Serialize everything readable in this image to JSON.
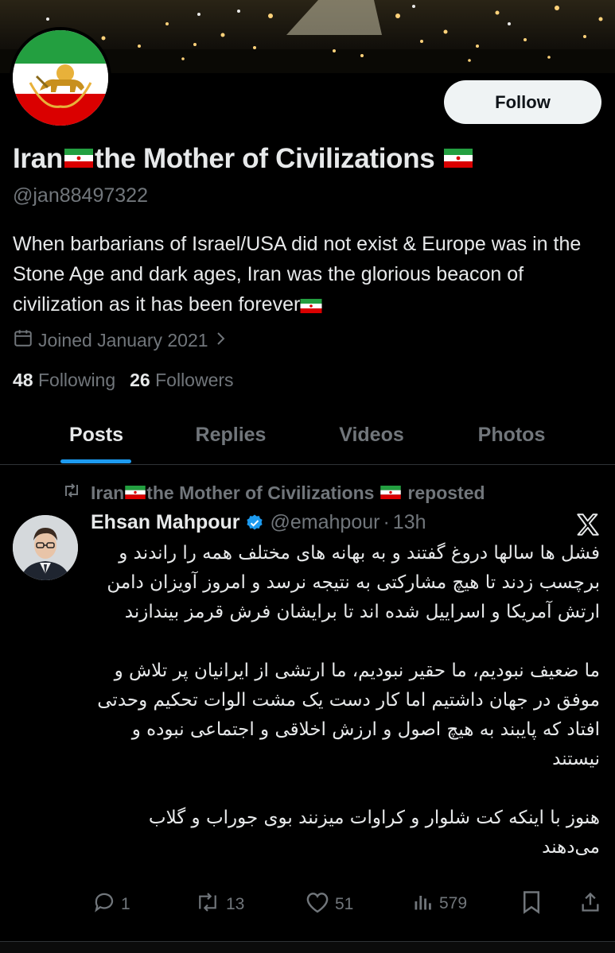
{
  "profile": {
    "name_part1": "Iran",
    "name_part2": "the Mother of Civilizations",
    "handle": "@jan88497322",
    "bio": "When barbarians of Israel/USA did not exist & Europe was in the Stone Age and dark ages, Iran was the glorious beacon of civilization as it has been forever",
    "joined": "Joined January 2021",
    "following_count": "48",
    "following_label": "Following",
    "followers_count": "26",
    "followers_label": "Followers",
    "follow_button": "Follow"
  },
  "tabs": [
    {
      "label": "Posts",
      "active": true
    },
    {
      "label": "Replies",
      "active": false
    },
    {
      "label": "Videos",
      "active": false
    },
    {
      "label": "Photos",
      "active": false
    }
  ],
  "post": {
    "repost_name_part1": "Iran",
    "repost_name_part2": "the Mother of Civilizations",
    "repost_suffix": "reposted",
    "author": "Ehsan Mahpour",
    "handle": "@emahpour",
    "separator": "·",
    "time": "13h",
    "paragraph1": "فشل ها سالها دروغ گفتند و به بهانه های مختلف همه را راندند و برچسب زدند تا هیچ مشارکتی به نتیجه نرسد و امروز آویزان دامن ارتش آمریکا و اسراییل شده اند تا برایشان فرش قرمز بیندازند",
    "paragraph2": "ما ضعیف نبودیم، ما حقیر نبودیم، ما ارتشی از ایرانیان پر تلاش و موفق در جهان داشتیم اما کار دست یک مشت الوات تحکیم وحدتی افتاد که پایبند به هیچ اصول و ارزش اخلاقی و اجتماعی نبوده و نیستند",
    "paragraph3": "هنوز با اینکه کت شلوار و کراوات میزنند بوی جوراب و گلاب می‌دهند",
    "replies": "1",
    "reposts": "13",
    "likes": "51",
    "views": "579"
  },
  "icons": {
    "calendar": "calendar-icon",
    "chevron": "chevron-right-icon",
    "repost": "repost-icon",
    "verified": "verified-badge-icon",
    "x_logo": "x-logo-icon",
    "reply": "reply-icon",
    "like": "heart-icon",
    "views": "views-icon",
    "bookmark": "bookmark-icon",
    "share": "share-icon"
  },
  "colors": {
    "background": "#000000",
    "accent": "#1d9bf0",
    "muted": "#71767b",
    "text": "#e7e9ea",
    "follow_bg": "#eff3f4"
  }
}
